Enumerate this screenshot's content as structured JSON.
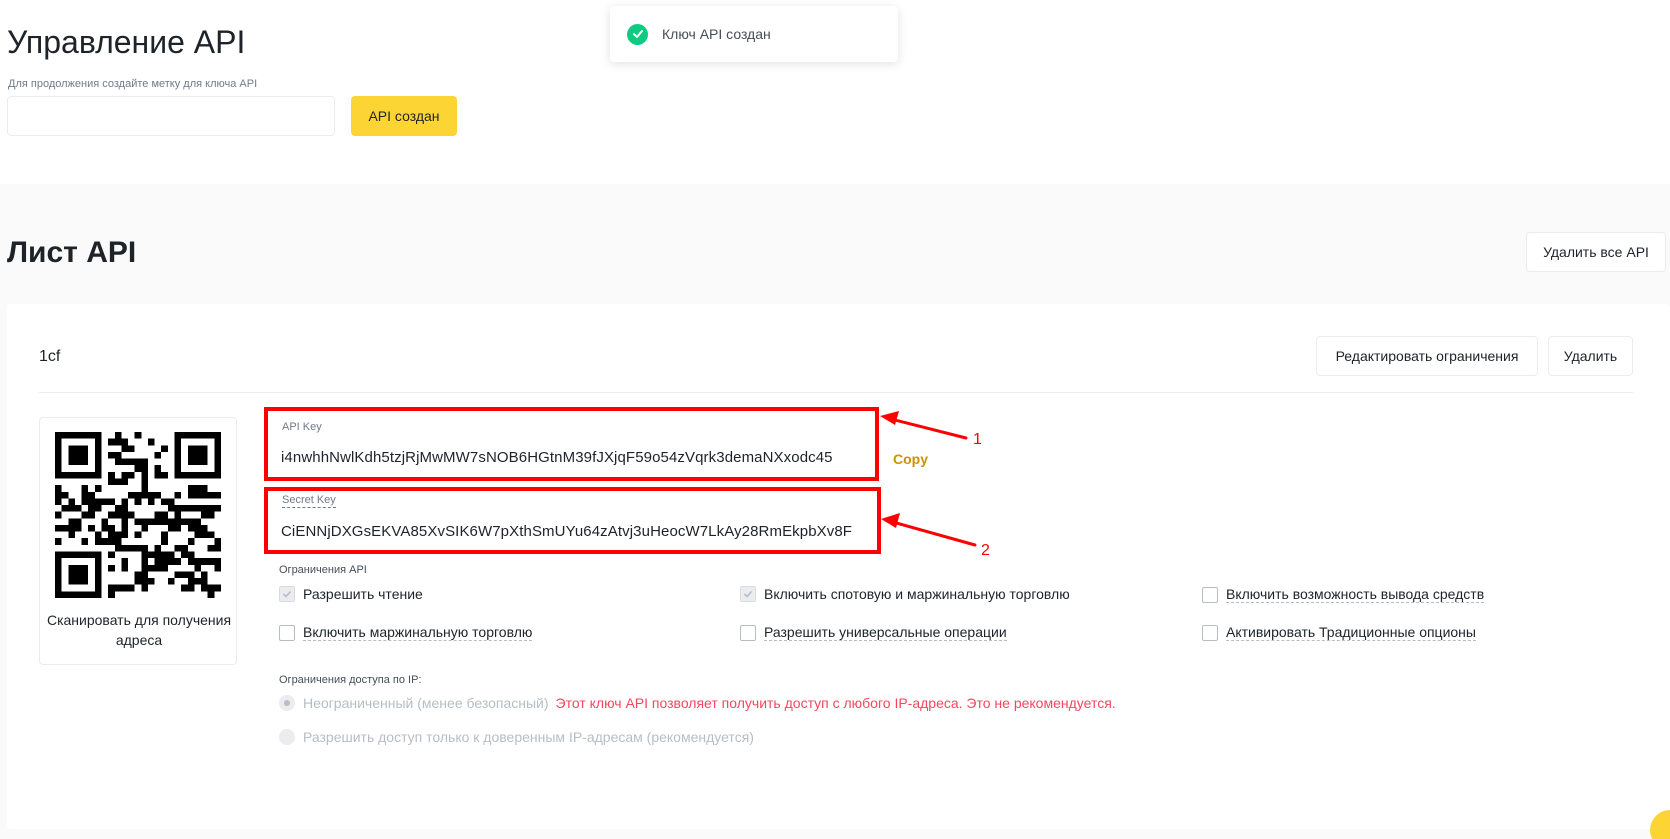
{
  "header": {
    "title": "Управление API",
    "hint": "Для продолжения создайте метку для ключа API",
    "label_input_value": "",
    "create_button": "API создан"
  },
  "toast": {
    "icon": "check-circle-icon",
    "text": "Ключ API создан"
  },
  "list": {
    "title": "Лист API",
    "delete_all_button": "Удалить все API"
  },
  "card": {
    "name": "1cf",
    "edit_button": "Редактировать ограничения",
    "delete_button": "Удалить",
    "qr_caption": "Сканировать для получения адреса",
    "api_key_label": "API Key",
    "api_key_value": "i4nwhhNwlKdh5tzjRjMwMW7sNOB6HGtnM39fJXjqF59o54zVqrk3demaNXxodc45",
    "copy_link": "Copy",
    "secret_key_label": "Secret Key",
    "secret_key_value": "CiENNjDXGsEKVA85XvSIK6W7pXthSmUYu64zAtvj3uHeocW7LkAy28RmEkpbXv8F",
    "annotation_1": "1",
    "annotation_2": "2",
    "restrictions_title": "Ограничения API",
    "permissions": [
      {
        "label": "Разрешить чтение",
        "checked": true
      },
      {
        "label": "Включить спотовую и маржинальную торговлю",
        "checked": true
      },
      {
        "label": "Включить возможность вывода средств",
        "checked": false
      },
      {
        "label": "Включить маржинальную торговлю",
        "checked": false
      },
      {
        "label": "Разрешить универсальные операции",
        "checked": false
      },
      {
        "label": "Активировать Традиционные опционы",
        "checked": false
      }
    ],
    "ip_title": "Ограничения доступа по IP:",
    "ip_unrestricted": "Неограниченный (менее безопасный)",
    "ip_warning": "Этот ключ API позволяет получить доступ с любого IP-адреса. Это не рекомендуется.",
    "ip_trusted": "Разрешить доступ только к доверенным IP-адресам (рекомендуется)"
  },
  "colors": {
    "accent": "#fcd535",
    "success": "#0ecb81",
    "annotation": "#ff0000",
    "warning": "#f6465d",
    "link": "#c99400"
  }
}
